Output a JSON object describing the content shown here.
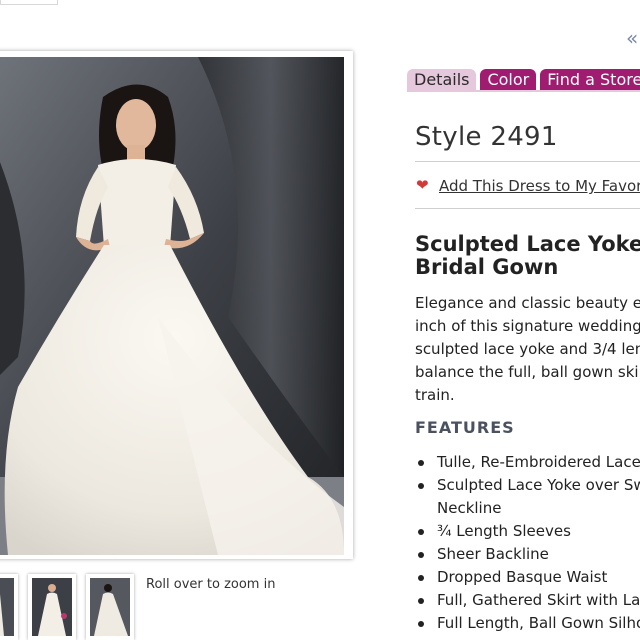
{
  "nav": {
    "collapse_arrows": "«"
  },
  "tabs": [
    {
      "label": "Details",
      "state": "active"
    },
    {
      "label": "Color",
      "state": "inactive"
    },
    {
      "label": "Find a Store",
      "state": "inactive"
    }
  ],
  "product": {
    "style_title": "Style 2491",
    "favorite_icon": "heart-icon",
    "favorite_link": "Add This Dress to My Favor",
    "name_line1": "Sculpted Lace Yoke A",
    "name_line2": "Bridal Gown",
    "description_lines": [
      "Elegance and classic beauty ex",
      "inch of this signature wedding d",
      "sculpted lace yoke and 3/4 len",
      "balance the full, ball gown skirt",
      "train."
    ]
  },
  "features": {
    "heading": "FEATURES",
    "items": [
      "Tulle, Re-Embroidered Lace,",
      "Sculpted Lace Yoke over Sw",
      "Neckline",
      "¾ Length Sleeves",
      "Sheer Backline",
      "Dropped Basque Waist",
      "Full, Gathered Skirt with Lac",
      "Full Length, Ball Gown Silho"
    ]
  },
  "gallery": {
    "zoom_hint": "Roll over to zoom in"
  },
  "colors": {
    "tab_active_bg": "#e6c8dc",
    "tab_inactive_bg": "#a01c70",
    "heart": "#d23a3a"
  }
}
